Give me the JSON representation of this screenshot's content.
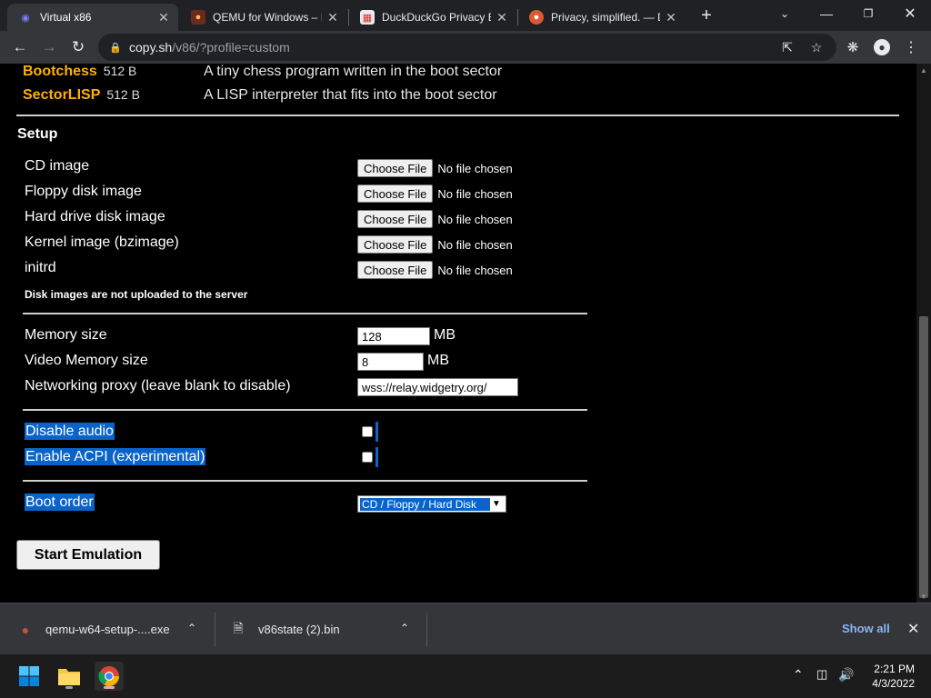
{
  "browser": {
    "tabs": [
      {
        "title": "Virtual x86",
        "active": true,
        "favicon": "v86-icon"
      },
      {
        "title": "QEMU for Windows – I",
        "active": false,
        "favicon": "qemu-icon"
      },
      {
        "title": "DuckDuckGo Privacy E",
        "active": false,
        "favicon": "store-icon"
      },
      {
        "title": "Privacy, simplified. — D",
        "active": false,
        "favicon": "duckduckgo-icon"
      }
    ],
    "url_host": "copy.sh",
    "url_path": "/v86/?profile=custom"
  },
  "os_list": [
    {
      "name": "Bootchess",
      "size": "512 B",
      "description": "A tiny chess program written in the boot sector"
    },
    {
      "name": "SectorLISP",
      "size": "512 B",
      "description": "A LISP interpreter that fits into the boot sector"
    }
  ],
  "setup": {
    "title": "Setup",
    "files": [
      {
        "label": "CD image",
        "button": "Choose File",
        "status": "No file chosen"
      },
      {
        "label": "Floppy disk image",
        "button": "Choose File",
        "status": "No file chosen"
      },
      {
        "label": "Hard drive disk image",
        "button": "Choose File",
        "status": "No file chosen"
      },
      {
        "label": "Kernel image (bzimage)",
        "button": "Choose File",
        "status": "No file chosen"
      },
      {
        "label": "initrd",
        "button": "Choose File",
        "status": "No file chosen"
      }
    ],
    "disk_note": "Disk images are not uploaded to the server",
    "memory_label": "Memory size",
    "memory_value": "128",
    "memory_unit": "MB",
    "vmem_label": "Video Memory size",
    "vmem_value": "8",
    "vmem_unit": "MB",
    "proxy_label": "Networking proxy (leave blank to disable)",
    "proxy_value": "wss://relay.widgetry.org/",
    "disable_audio_label": "Disable audio",
    "disable_audio_checked": false,
    "acpi_label": "Enable ACPI (experimental)",
    "acpi_checked": false,
    "boot_order_label": "Boot order",
    "boot_order_value": "CD / Floppy / Hard Disk",
    "start_button": "Start Emulation"
  },
  "downloads": {
    "items": [
      {
        "name": "qemu-w64-setup-....exe",
        "icon": "qemu-icon"
      },
      {
        "name": "v86state (2).bin",
        "icon": "file-icon"
      }
    ],
    "show_all": "Show all"
  },
  "taskbar": {
    "time": "2:21 PM",
    "date": "4/3/2022"
  },
  "colors": {
    "accent_selection": "#0a63c9",
    "os_name": "#ffb000",
    "link": "#8ab4f8"
  }
}
